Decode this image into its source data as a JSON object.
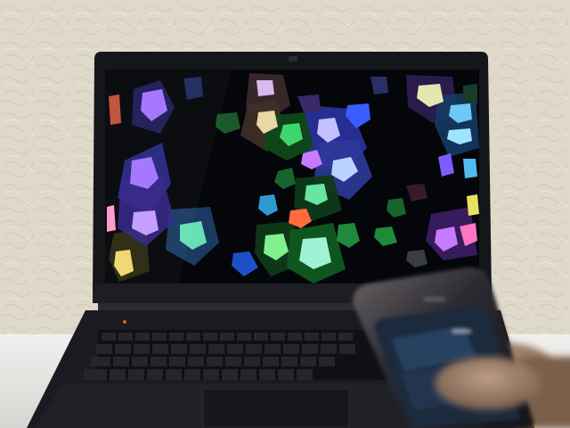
{
  "scene": {
    "wall_color": "#ddd6c6",
    "wall_shadow_color": "#b9ad98",
    "table_color": "#ecebea",
    "laptop_body_color": "#15161a",
    "screen_background": "#06070b",
    "phone_body_color": "#2b2a30",
    "phone_screen_color": "#1a2b3c",
    "finger_color": "#9b8068"
  },
  "screen_pattern": {
    "description_colors": [
      "#a474ff",
      "#7c5cff",
      "#3b8cff",
      "#3ed66b",
      "#e9d8a6",
      "#ff6b3a",
      "#68e0b5",
      "#c67cff",
      "#ff75c1",
      "#4fbcf2"
    ]
  }
}
